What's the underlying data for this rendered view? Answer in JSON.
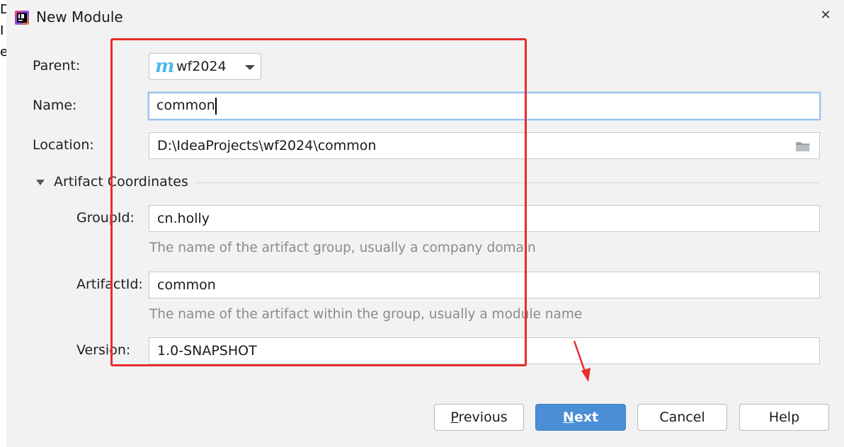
{
  "window": {
    "title": "New Module"
  },
  "form": {
    "parent_label": "Parent:",
    "parent_value": "wf2024",
    "name_label": "Name:",
    "name_value": "common",
    "location_label": "Location:",
    "location_value": "D:\\IdeaProjects\\wf2024\\common",
    "section_title": "Artifact Coordinates",
    "groupid_label": "GroupId:",
    "groupid_value": "cn.holly",
    "groupid_hint": "The name of the artifact group, usually a company domain",
    "artifactid_label": "ArtifactId:",
    "artifactid_value": "common",
    "artifactid_hint": "The name of the artifact within the group, usually a module name",
    "version_label": "Version:",
    "version_value": "1.0-SNAPSHOT"
  },
  "buttons": {
    "previous_mnemonic": "P",
    "previous_rest": "revious",
    "next_mnemonic": "N",
    "next_rest": "ext",
    "cancel": "Cancel",
    "help": "Help"
  },
  "icons": {
    "app": "intellij-idea-icon",
    "parent": "maven-module-icon",
    "dropdown": "chevron-down-icon",
    "browse": "folder-icon",
    "close": "close-icon",
    "section_toggle": "triangle-down-icon"
  },
  "colors": {
    "primary_button": "#4a8fd5",
    "focus_border": "#97c3ee",
    "annotation": "#e92c2c",
    "hint_text": "#8a8a8a"
  }
}
